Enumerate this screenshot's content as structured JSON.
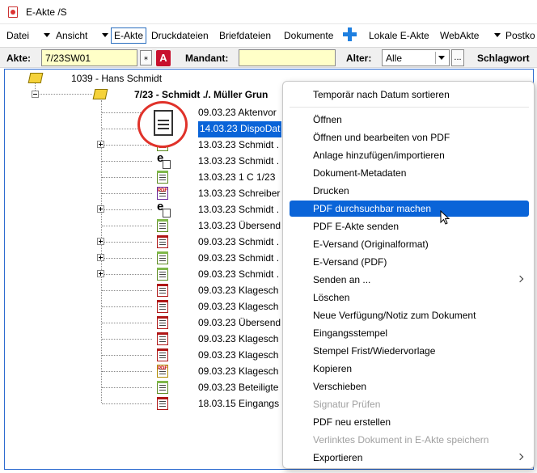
{
  "window": {
    "title": "E-Akte /S"
  },
  "menu": {
    "datei": "Datei",
    "ansicht": "Ansicht",
    "eakte": "E-Akte",
    "druckdateien": "Druckdateien",
    "briefdateien": "Briefdateien",
    "dokumente": "Dokumente",
    "lokale": "Lokale E-Akte",
    "webakte": "WebAkte",
    "postko": "Postko"
  },
  "search": {
    "akte_label": "Akte:",
    "akte_value": "7/23SW01",
    "mandant_label": "Mandant:",
    "mandant_value": "",
    "alter_label": "Alter:",
    "alter_value": "Alle",
    "dots": "...",
    "schlagwort_label": "Schlagwort"
  },
  "tree": {
    "root_label": "1039 - Hans Schmidt",
    "case_label": "7/23 - Schmidt ./. Müller Grun",
    "docs": [
      {
        "text": "09.03.23 Aktenvor",
        "icon": "doc-icon"
      },
      {
        "text": "14.03.23 DispoDat",
        "icon": "doc-icon"
      },
      {
        "text": "13.03.23 Schmidt .",
        "icon": "doc-icon"
      },
      {
        "text": "13.03.23 Schmidt .",
        "icon": "email-doc-icon"
      },
      {
        "text": "13.03.23 1 C 1/23",
        "icon": "doc-icon"
      },
      {
        "text": "13.03.23 Schreiber",
        "icon": "pdf-icon"
      },
      {
        "text": "13.03.23 Schmidt .",
        "icon": "email-doc-icon"
      },
      {
        "text": "13.03.23 Übersend",
        "icon": "doc-icon"
      },
      {
        "text": "09.03.23 Schmidt .",
        "icon": "doc-icon"
      },
      {
        "text": "09.03.23 Schmidt .",
        "icon": "doc-icon"
      },
      {
        "text": "09.03.23 Schmidt .",
        "icon": "doc-icon"
      },
      {
        "text": "09.03.23 Klagesch",
        "icon": "doc-icon"
      },
      {
        "text": "09.03.23 Klagesch",
        "icon": "doc-icon"
      },
      {
        "text": "09.03.23 Übersend",
        "icon": "doc-icon"
      },
      {
        "text": "09.03.23 Klagesch",
        "icon": "doc-icon"
      },
      {
        "text": "09.03.23 Klagesch",
        "icon": "doc-icon"
      },
      {
        "text": "09.03.23 Klagesch",
        "icon": "pdf-icon"
      },
      {
        "text": "09.03.23 Beteiligte",
        "icon": "doc-icon"
      },
      {
        "text": "18.03.15 Eingangs",
        "icon": "doc-icon"
      }
    ]
  },
  "context_menu": {
    "items": [
      {
        "label": "Temporär nach Datum sortieren"
      },
      {
        "label": "Öffnen"
      },
      {
        "label": "Öffnen und bearbeiten von PDF"
      },
      {
        "label": "Anlage hinzufügen/importieren"
      },
      {
        "label": "Dokument-Metadaten"
      },
      {
        "label": "Drucken"
      },
      {
        "label": "PDF durchsuchbar machen"
      },
      {
        "label": "PDF E-Akte senden"
      },
      {
        "label": "E-Versand (Originalformat)"
      },
      {
        "label": "E-Versand (PDF)"
      },
      {
        "label": "Senden an ..."
      },
      {
        "label": "Löschen"
      },
      {
        "label": "Neue Verfügung/Notiz zum Dokument"
      },
      {
        "label": "Eingangsstempel"
      },
      {
        "label": "Stempel Frist/Wiedervorlage"
      },
      {
        "label": "Kopieren"
      },
      {
        "label": "Verschieben"
      },
      {
        "label": "Signatur Prüfen"
      },
      {
        "label": "PDF neu erstellen"
      },
      {
        "label": "Verlinktes Dokument in E-Akte speichern"
      },
      {
        "label": "Exportieren"
      }
    ]
  },
  "colors": {
    "selection": "#0a64d8",
    "input_bg": "#ffffc8",
    "accent_blue": "#1e7fe0",
    "highlight_circle": "#e0322a"
  }
}
